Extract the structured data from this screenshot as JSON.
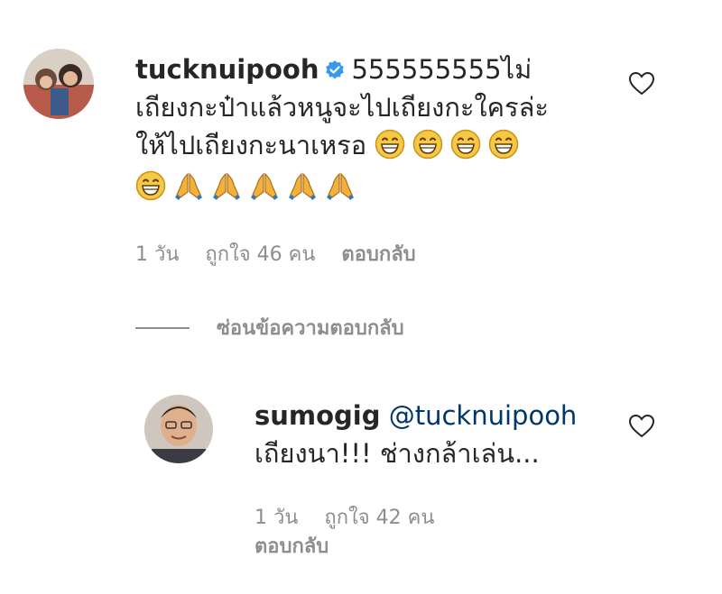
{
  "comment1": {
    "username": "tucknuipooh",
    "verified": true,
    "text_line1": "555555555ไม่",
    "text_line2": "เถียงกะป๋าแล้วหนูจะไปเถียงกะใครล่ะ",
    "text_line3": "ให้ไปเถียงกะนาเหรอ",
    "grin_emoji_count": 5,
    "pray_emoji_count": 5,
    "time": "1 วัน",
    "likes": "ถูกใจ 46 คน",
    "reply_label": "ตอบกลับ"
  },
  "hide_replies_label": "ซ่อนข้อความตอบกลับ",
  "reply1": {
    "username": "sumogig",
    "mention": "@tucknuipooh",
    "text": "เถียงนา!!! ช่างกล้าเล่น...",
    "time": "1 วัน",
    "likes": "ถูกใจ 42 คน",
    "reply_label": "ตอบกลับ"
  },
  "icons": {
    "heart": "heart-outline-icon",
    "verified": "verified-badge-icon",
    "grin": "grinning-face-emoji",
    "pray": "folded-hands-emoji"
  },
  "colors": {
    "text": "#262626",
    "muted": "#8e8e8e",
    "mention": "#00376b",
    "verified": "#3897f0"
  }
}
